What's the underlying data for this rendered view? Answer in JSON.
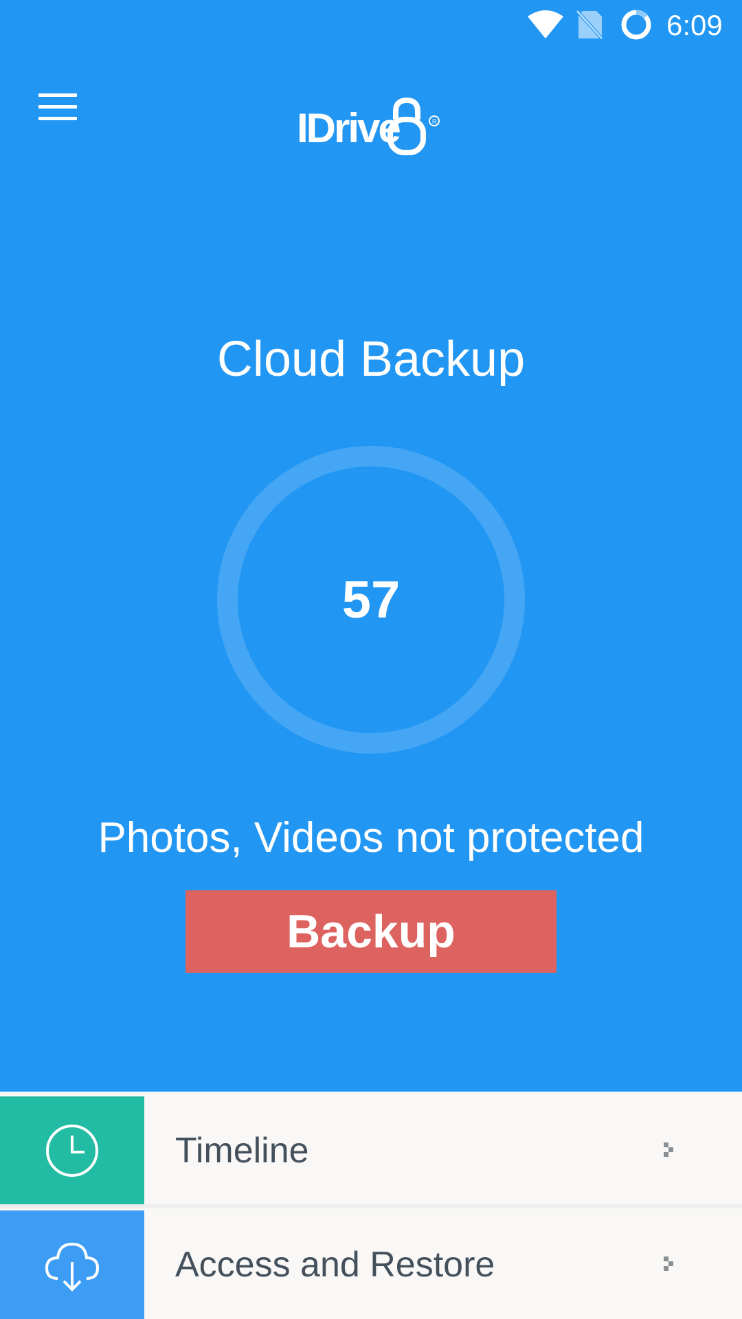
{
  "status_bar": {
    "time": "6:09",
    "icons": [
      "wifi-icon",
      "no-sim-icon",
      "battery-ring-icon"
    ]
  },
  "header": {
    "menu_icon": "hamburger-menu-icon",
    "logo_text": "IDrive"
  },
  "main": {
    "title": "Cloud Backup",
    "count": "57",
    "status_text": "Photos, Videos not protected",
    "backup_label": "Backup"
  },
  "list": [
    {
      "label": "Timeline",
      "icon": "clock-icon",
      "tile_color": "#22bba3"
    },
    {
      "label": "Access and Restore",
      "icon": "cloud-download-icon",
      "tile_color": "#3d9df4"
    }
  ],
  "colors": {
    "primary": "#2196f3",
    "backup_button": "#dd6360",
    "list_background": "#f9f8f6",
    "list_text": "#44505c"
  }
}
